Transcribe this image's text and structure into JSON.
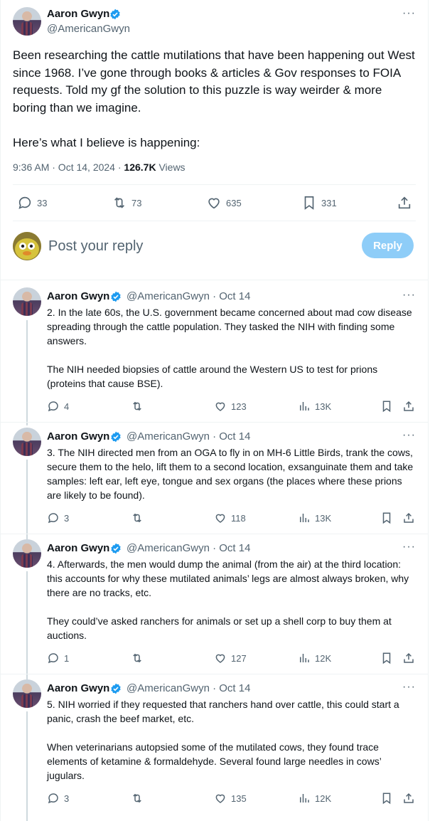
{
  "main_tweet": {
    "author_name": "Aaron Gwyn",
    "handle": "@AmericanGwyn",
    "more": "···",
    "text": "Been researching the cattle mutilations that have been happening out West since 1968. I’ve gone through books & articles & Gov responses to FOIA requests. Told my gf the solution to this puzzle is way weirder & more boring than we imagine.\n\nHere’s what I believe is happening:",
    "timestamp": "9:36 AM · Oct 14, 2024 · ",
    "views_count": "126.7K",
    "views_label": " Views",
    "actions": {
      "replies": "33",
      "retweets": "73",
      "likes": "635",
      "bookmarks": "331"
    }
  },
  "reply_box": {
    "placeholder": "Post your reply",
    "button": "Reply"
  },
  "thread": [
    {
      "author_name": "Aaron Gwyn",
      "meta": "@AmericanGwyn · Oct 14",
      "more": "···",
      "text": "2. In the late 60s, the U.S. government became concerned about mad cow disease spreading through the cattle population. They tasked the NIH with finding some answers.\n\nThe NIH needed biopsies of cattle around the Western US to test for prions (proteins that cause BSE).",
      "replies": "4",
      "retweets": "",
      "likes": "123",
      "views": "13K"
    },
    {
      "author_name": "Aaron Gwyn",
      "meta": "@AmericanGwyn · Oct 14",
      "more": "···",
      "text": "3. The NIH directed men from an OGA to fly in on MH-6 Little Birds, trank the cows, secure them to the helo, lift them to a second location, exsanguinate them and take samples: left ear, left eye, tongue and sex organs (the places where these prions are likely to be found).",
      "replies": "3",
      "retweets": "",
      "likes": "118",
      "views": "13K"
    },
    {
      "author_name": "Aaron Gwyn",
      "meta": "@AmericanGwyn · Oct 14",
      "more": "···",
      "text": "4. Afterwards, the men would dump the animal (from the air) at the third location: this accounts for why these mutilated animals’ legs are almost always broken, why there are no tracks, etc.\n\nThey could’ve asked ranchers for animals or set up a shell corp to buy them at auctions.",
      "replies": "1",
      "retweets": "",
      "likes": "127",
      "views": "12K"
    },
    {
      "author_name": "Aaron Gwyn",
      "meta": "@AmericanGwyn · Oct 14",
      "more": "···",
      "text": "5. NIH worried if they requested that ranchers hand over cattle, this could start a panic, crash the beef market, etc.\n\nWhen veterinarians autopsied some of the mutilated cows, they found trace elements of ketamine & formaldehyde. Several found large needles in cows’ jugulars.",
      "replies": "3",
      "retweets": "",
      "likes": "135",
      "views": "12K"
    }
  ],
  "colors": {
    "accent": "#1d9bf0",
    "reply_button": "#8ecdf8",
    "muted": "#536471"
  }
}
